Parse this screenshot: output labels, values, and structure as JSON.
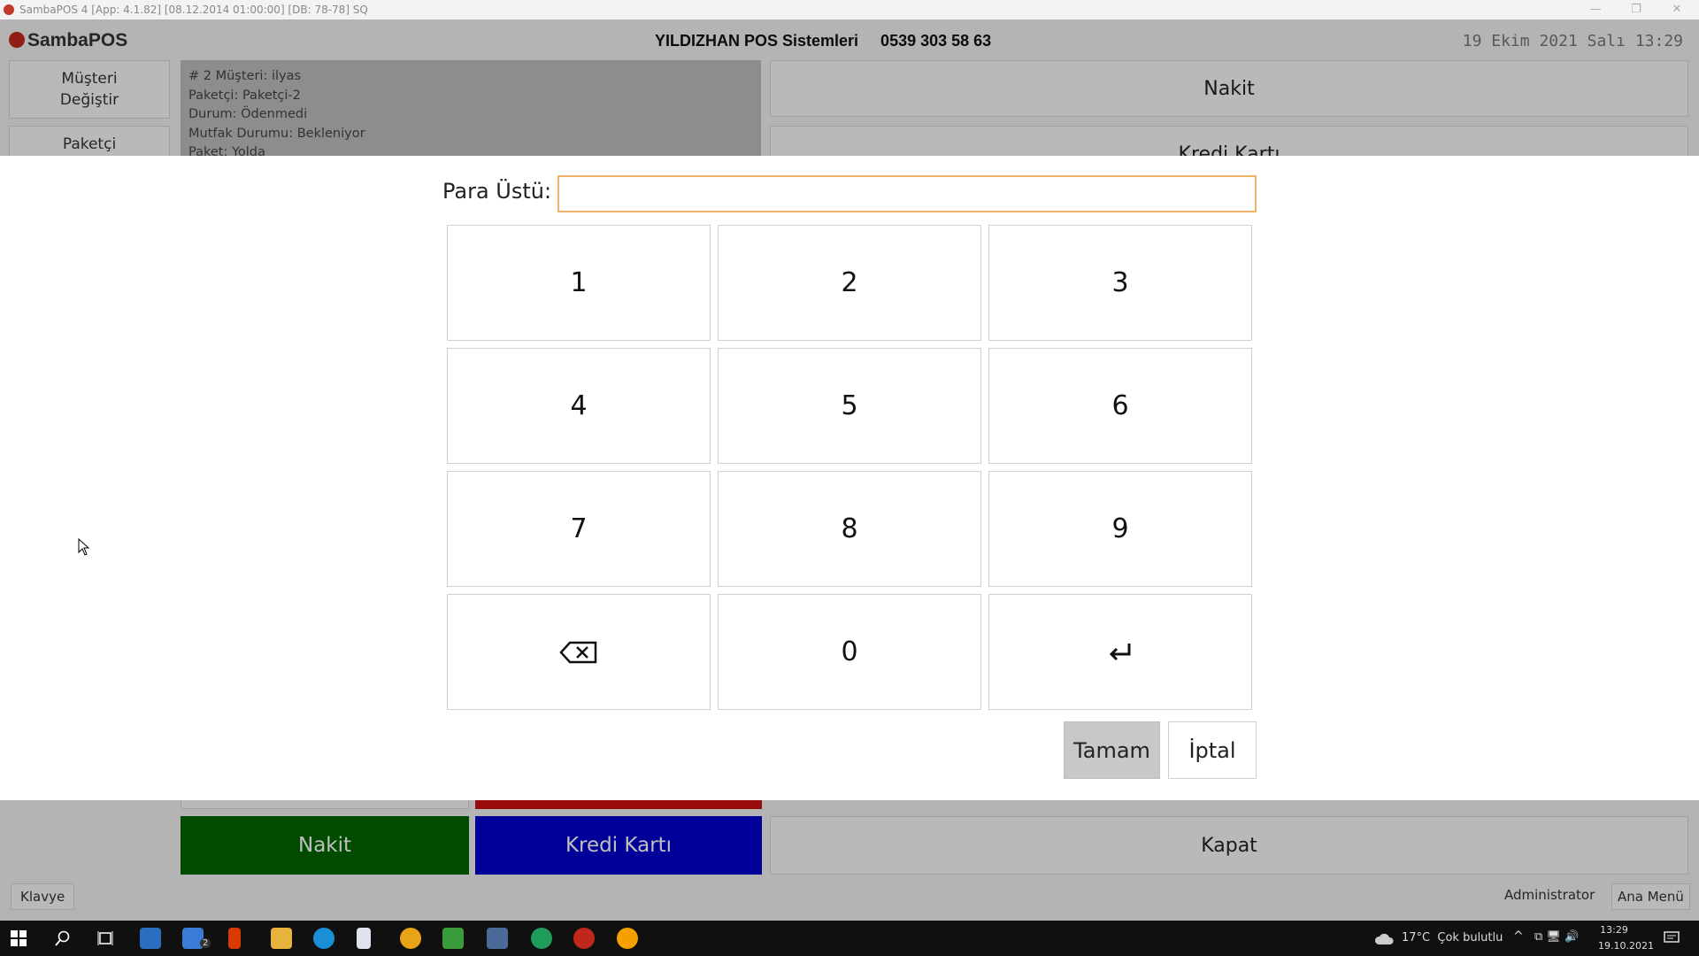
{
  "titlebar": {
    "text": "SambaPOS 4 [App: 4.1.82] [08.12.2014 01:00:00] [DB: 78-78] SQ"
  },
  "header": {
    "logo": "SambaPOS",
    "company": "YILDIZHAN POS Sistemleri     0539 303 58 63",
    "clock": "19 Ekim 2021 Salı 13:29"
  },
  "left": {
    "change_customer": "Müşteri Değiştir",
    "courier": "Paketçi"
  },
  "ticket": {
    "lines": [
      "# 2 Müşteri: ilyas",
      "Paketçi: Paketçi-2",
      "Durum: Ödenmedi",
      "Mutfak Durumu: Bekleniyor",
      "Paket: Yolda"
    ]
  },
  "right": {
    "cash": "Nakit",
    "card": "Kredi Kartı",
    "close": "Kapat"
  },
  "bottom": {
    "cash": "Nakit",
    "card": "Kredi Kartı",
    "cash_color": "#006400",
    "card_color": "#0000cc"
  },
  "footer": {
    "keyboard": "Klavye",
    "user": "Administrator",
    "main_menu": "Ana Menü"
  },
  "dialog": {
    "label": "Para Üstü:",
    "input_value": "",
    "keys": [
      "1",
      "2",
      "3",
      "4",
      "5",
      "6",
      "7",
      "8",
      "9",
      "⌫",
      "0",
      "↵"
    ],
    "ok": "Tamam",
    "cancel": "İptal"
  },
  "taskbar": {
    "weather": "17°C  Çok bulutlu",
    "time": "13:29",
    "date": "19.10.2021",
    "mail_badge": "2"
  }
}
